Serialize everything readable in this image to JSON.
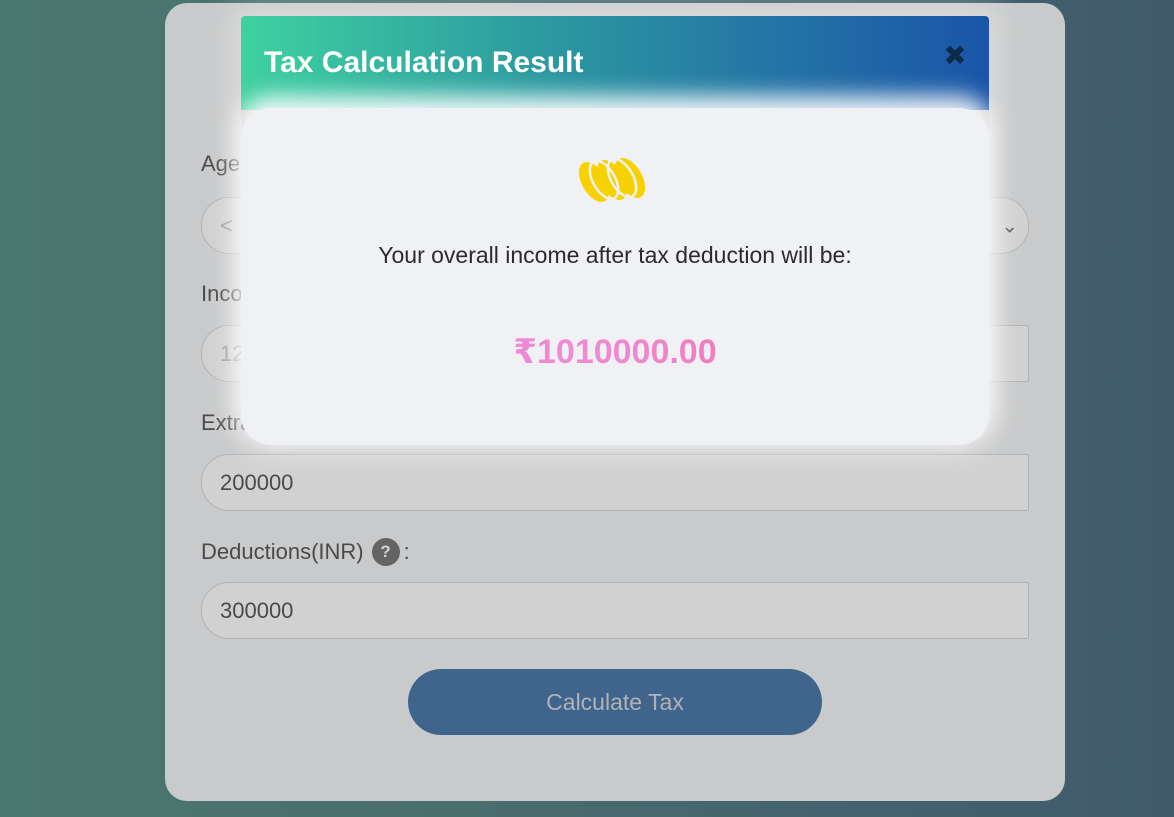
{
  "form": {
    "age_label": "Age",
    "age_value": "<",
    "income_label": "Income",
    "income_value": "12",
    "extra_label": "Extra",
    "extra_value": "200000",
    "deductions_label": "Deductions(INR)",
    "deductions_suffix": ":",
    "deductions_help": "?",
    "deductions_value": "300000",
    "submit_label": "Calculate Tax"
  },
  "modal": {
    "title": "Tax Calculation Result",
    "close_symbol": "✖",
    "icon": "coins-icon",
    "message": "Your overall income after tax deduction will be:",
    "amount": "₹1010000.00"
  },
  "colors": {
    "header_start": "#3fd1a0",
    "header_end": "#1a55a8",
    "amount_start": "#e986e8",
    "amount_end": "#ef5a8a",
    "button": "#0e4c8c",
    "coin": "#f7d200"
  }
}
